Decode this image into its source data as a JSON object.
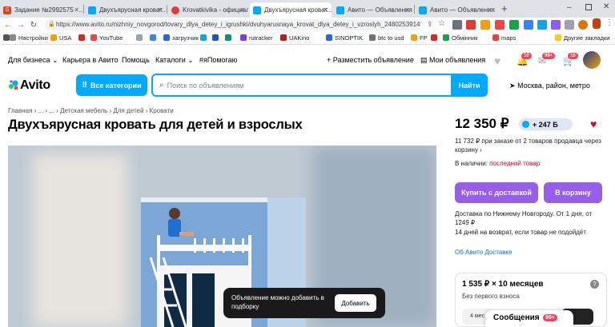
{
  "browser": {
    "tabs": [
      {
        "title": "Задание №2992575 - ..."
      },
      {
        "title": "Двухъярусная кроват..."
      },
      {
        "title": "Krovatkivika - официал..."
      },
      {
        "title": "Двухъярусная кроват..."
      },
      {
        "title": "Авито — Объявления ..."
      },
      {
        "title": "Авито — Объявления ..."
      }
    ],
    "url": "https://www.avito.ru/nizhniy_novgorod/tovary_dlya_detey_i_igrushki/dvuhyarusnaya_krovat_dlya_detey_i_vzroslyh_2480253914?slo...",
    "bookmarks": [
      "Настройки",
      "USA",
      "",
      "YouTube",
      "",
      "",
      "загрузчик",
      "",
      "",
      "",
      "rutracker",
      "UAKino",
      "SINOPTIK",
      "btc to usd",
      "FP",
      "",
      "Обмінник",
      "maps",
      "Другие закладки"
    ]
  },
  "topnav": {
    "business": "Для бизнеса",
    "career": "Карьера в Авито",
    "help": "Помощь",
    "catalogs": "Каталоги",
    "hashtag": "#яПомогаю",
    "post_ad": "+ Разместить объявление",
    "my_ads": "Мои объявления",
    "badge1": "10",
    "badge2": "99+",
    "badge3": "16"
  },
  "header": {
    "logo": "Avito",
    "all_categories": "Все категории",
    "search_placeholder": "Поиск по объявлениям",
    "find": "Найти",
    "location": "Москва, район, метро"
  },
  "breadcrumbs": "Главная › ... › ... › Детская мебель › Для детей › Кровати",
  "listing": {
    "title": "Двухъярусная кровать для детей и взрослых",
    "price": "12 350 ₽",
    "bonus": "+ 247 Б",
    "promo": "11 732 ₽ при заказе от 2 товаров продавца через корзину",
    "stock_label": "В наличии:",
    "stock_value": "последний товар",
    "buy_delivery": "Купить с доставкой",
    "to_cart": "В корзину",
    "delivery_text": "Доставка по Нижнему Новгороду. От 1 дня, от 1249 ₽",
    "return_text": "14 дней на возврат, если товар не подойдёт",
    "about_delivery": "Об Авито Доставке",
    "installment": "1 535 ₽ × 10 месяцев",
    "no_down": "Без первого взноса",
    "months_short": "4 мес"
  },
  "toast": {
    "text": "Объявление можно добавить в подборку",
    "button": "Добавить"
  },
  "messages": {
    "label": "Сообщения",
    "badge": "99+"
  },
  "colors": {
    "accent": "#00aaff",
    "purple": "#965eeb",
    "stock_red": "#e0002a"
  }
}
